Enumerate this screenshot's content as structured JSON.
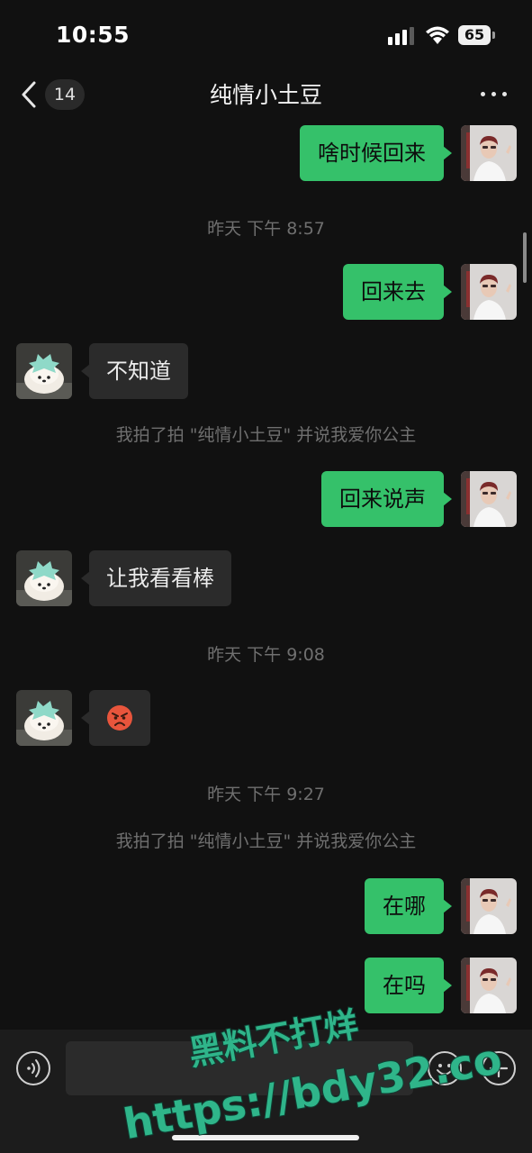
{
  "status_bar": {
    "time": "10:55",
    "battery": "65"
  },
  "header": {
    "back_badge": "14",
    "title": "纯情小土豆"
  },
  "messages": [
    {
      "side": "out",
      "text": "啥时候回来"
    },
    {
      "type": "time",
      "text": "昨天 下午 8:57"
    },
    {
      "side": "out",
      "text": "回来去"
    },
    {
      "side": "in",
      "text": "不知道"
    },
    {
      "type": "system",
      "text": "我拍了拍 \"纯情小土豆\" 并说我爱你公主"
    },
    {
      "side": "out",
      "text": "回来说声"
    },
    {
      "side": "in",
      "text": "让我看看棒"
    },
    {
      "type": "time",
      "text": "昨天 下午 9:08"
    },
    {
      "side": "in",
      "emoji": "angry-face-emoji"
    },
    {
      "type": "time",
      "text": "昨天 下午 9:27"
    },
    {
      "type": "system",
      "text": "我拍了拍 \"纯情小土豆\" 并说我爱你公主"
    },
    {
      "side": "out",
      "text": "在哪"
    },
    {
      "side": "out",
      "text": "在吗"
    }
  ],
  "watermark": {
    "line1": "黑料不打烊",
    "line2": "https://bdy32.co"
  },
  "colors": {
    "outgoing_bubble": "#35c16a",
    "incoming_bubble": "#2b2b2b",
    "background": "#111111",
    "watermark": "#2fb58a"
  },
  "icons": [
    "cellular-signal-icon",
    "wifi-icon",
    "battery-icon",
    "back-chevron-icon",
    "more-options-icon",
    "voice-input-icon",
    "emoji-icon",
    "add-icon"
  ]
}
